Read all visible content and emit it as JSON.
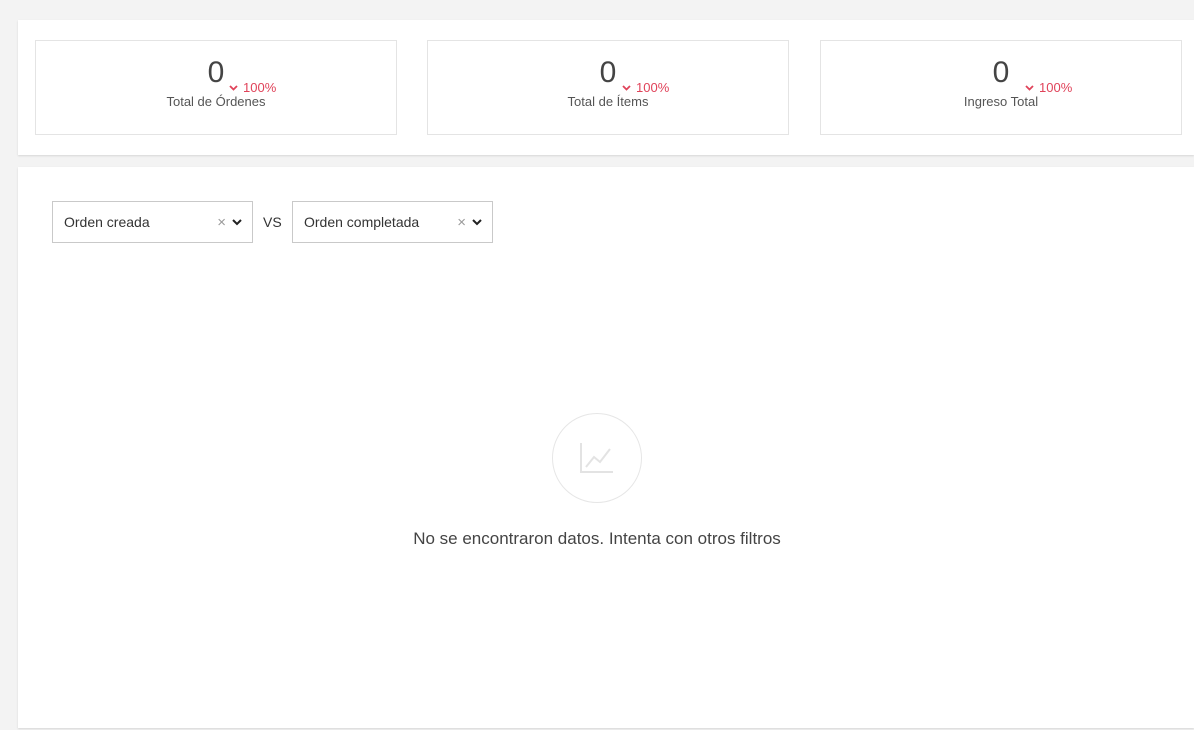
{
  "stats": [
    {
      "value": "0",
      "label": "Total de Órdenes",
      "change": "100%",
      "direction": "down"
    },
    {
      "value": "0",
      "label": "Total de Ítems",
      "change": "100%",
      "direction": "down"
    },
    {
      "value": "0",
      "label": "Ingreso Total",
      "change": "100%",
      "direction": "down"
    }
  ],
  "filters": {
    "first": {
      "value": "Orden creada",
      "clear_icon": "close-icon",
      "toggle_icon": "chevron-down-icon"
    },
    "vs_label": "VS",
    "second": {
      "value": "Orden completada",
      "clear_icon": "close-icon",
      "toggle_icon": "chevron-down-icon"
    }
  },
  "empty_state": {
    "icon": "line-chart-icon",
    "message": "No se encontraron datos. Intenta con otros filtros"
  },
  "colors": {
    "negative_change": "#e0435a",
    "background": "#f3f3f3",
    "panel": "#ffffff"
  }
}
